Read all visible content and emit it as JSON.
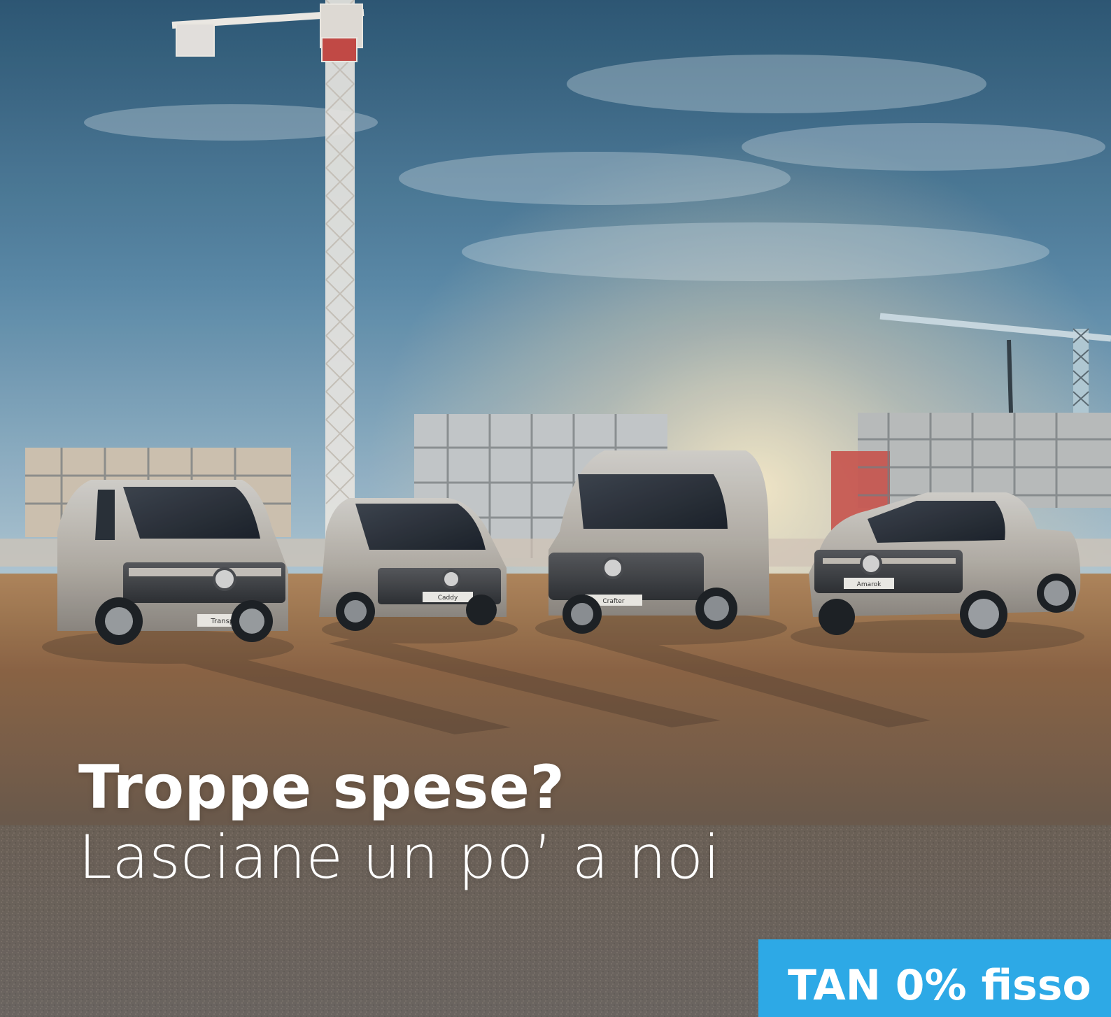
{
  "headline": {
    "line1": "Troppe spese?",
    "line2": "Lasciane un po’ a noi"
  },
  "offer": {
    "label": "TAN 0% fisso"
  },
  "vehicles": [
    {
      "name": "Transporter",
      "plate": "Transporter"
    },
    {
      "name": "Caddy",
      "plate": "Caddy"
    },
    {
      "name": "Crafter",
      "plate": "Crafter"
    },
    {
      "name": "Amarok",
      "plate": "Amarok"
    }
  ],
  "colors": {
    "badge": "#2da9e6",
    "headline": "#ffffff",
    "sky_top": "#3f6f92",
    "sky_horizon": "#f3e1cf",
    "ground": "#8b6747"
  }
}
